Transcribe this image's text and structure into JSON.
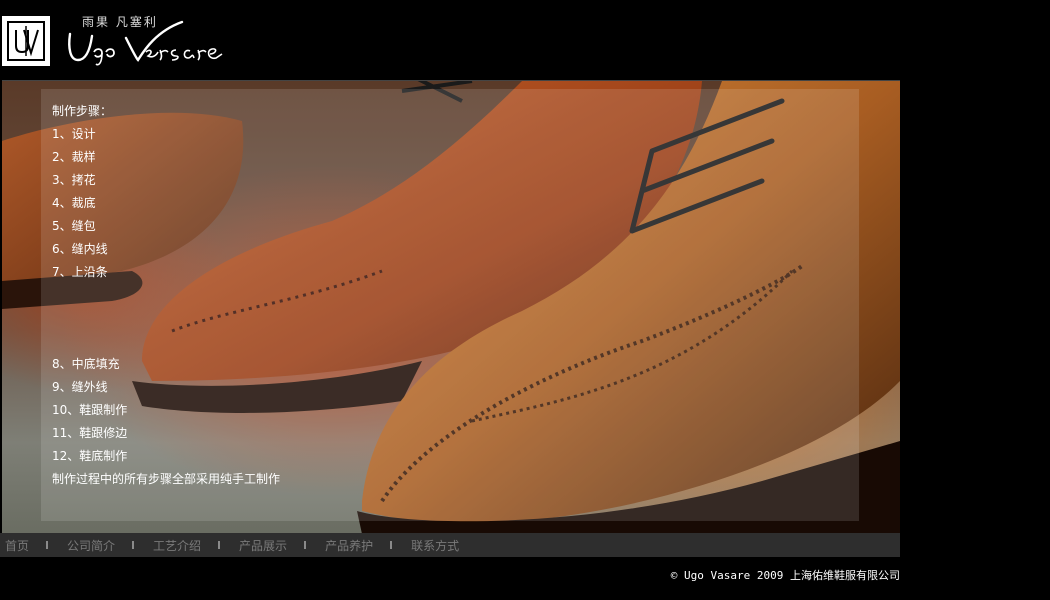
{
  "brand": {
    "cn_name": "雨果 凡塞利",
    "script_name": "Ugo Versare"
  },
  "steps": {
    "title": "制作步骤：",
    "items_a": [
      "1、设计",
      "2、裁样",
      "3、拷花",
      "4、裁底",
      "5、缝包",
      "6、缝内线",
      "7、上沿条"
    ],
    "items_b": [
      "8、中底填充",
      "9、缝外线",
      "10、鞋跟制作",
      "11、鞋跟修边",
      "12、鞋底制作"
    ],
    "note": "制作过程中的所有步骤全部采用纯手工制作"
  },
  "nav": {
    "items": [
      "首页",
      "公司简介",
      "工艺介绍",
      "产品展示",
      "产品养护",
      "联系方式"
    ]
  },
  "footer": {
    "copyright": "© Ugo Vasare 2009",
    "company": "上海佑维鞋服有限公司"
  },
  "colors": {
    "background": "#000000",
    "nav_bg": "#2e2e2e",
    "nav_text": "#7a7a7a"
  }
}
